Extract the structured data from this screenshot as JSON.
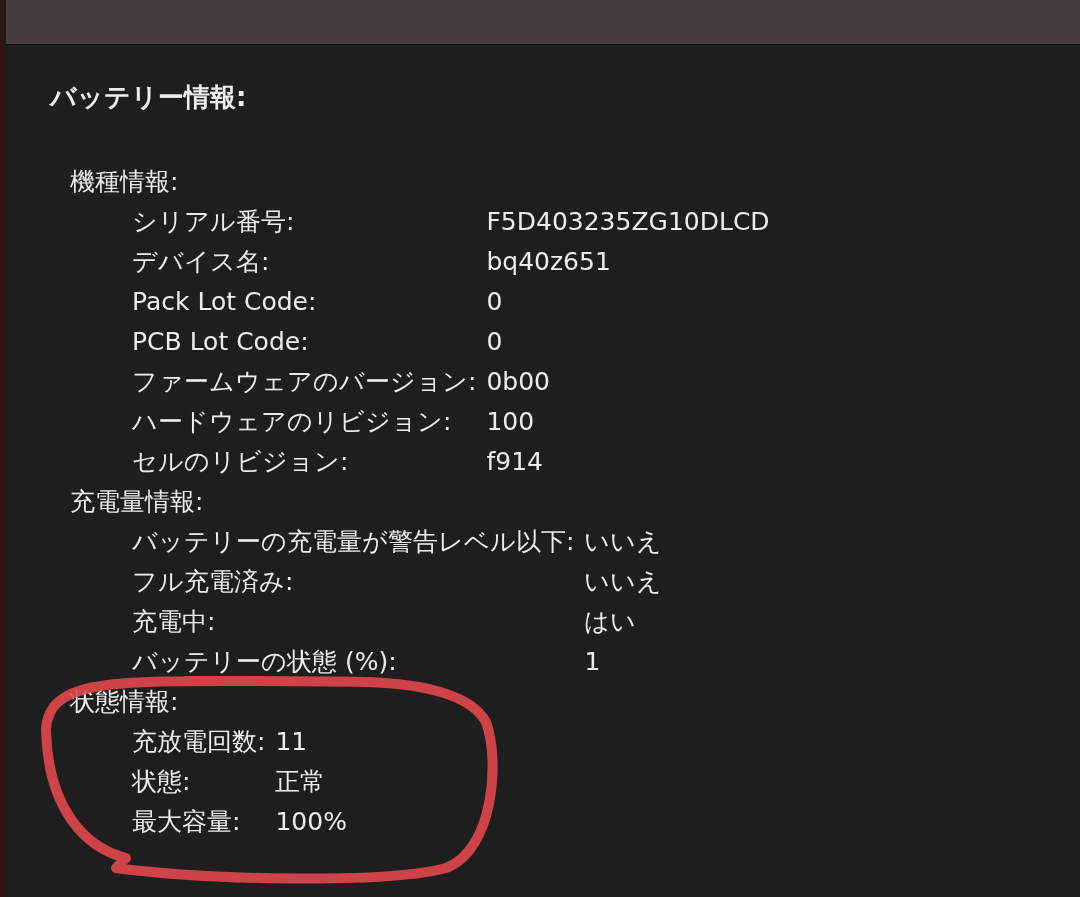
{
  "title": "バッテリー情報:",
  "sections": [
    {
      "heading": "機種情報:",
      "rows": [
        {
          "label": "シリアル番号:",
          "value": "F5D403235ZG10DLCD"
        },
        {
          "label": "デバイス名:",
          "value": "bq40z651"
        },
        {
          "label": "Pack Lot Code:",
          "value": "0"
        },
        {
          "label": "PCB Lot Code:",
          "value": "0"
        },
        {
          "label": "ファームウェアのバージョン:",
          "value": "0b00"
        },
        {
          "label": "ハードウェアのリビジョン:",
          "value": "100"
        },
        {
          "label": "セルのリビジョン:",
          "value": "f914"
        }
      ]
    },
    {
      "heading": "充電量情報:",
      "rows": [
        {
          "label": "バッテリーの充電量が警告レベル以下:",
          "value": "いいえ"
        },
        {
          "label": "フル充電済み:",
          "value": "いいえ"
        },
        {
          "label": "充電中:",
          "value": "はい"
        },
        {
          "label": "バッテリーの状態 (%):",
          "value": "1"
        }
      ]
    },
    {
      "heading": "状態情報:",
      "rows": [
        {
          "label": "充放電回数:",
          "value": "11"
        },
        {
          "label": "状態:",
          "value": "正常"
        },
        {
          "label": "最大容量:",
          "value": "100%"
        }
      ]
    }
  ]
}
